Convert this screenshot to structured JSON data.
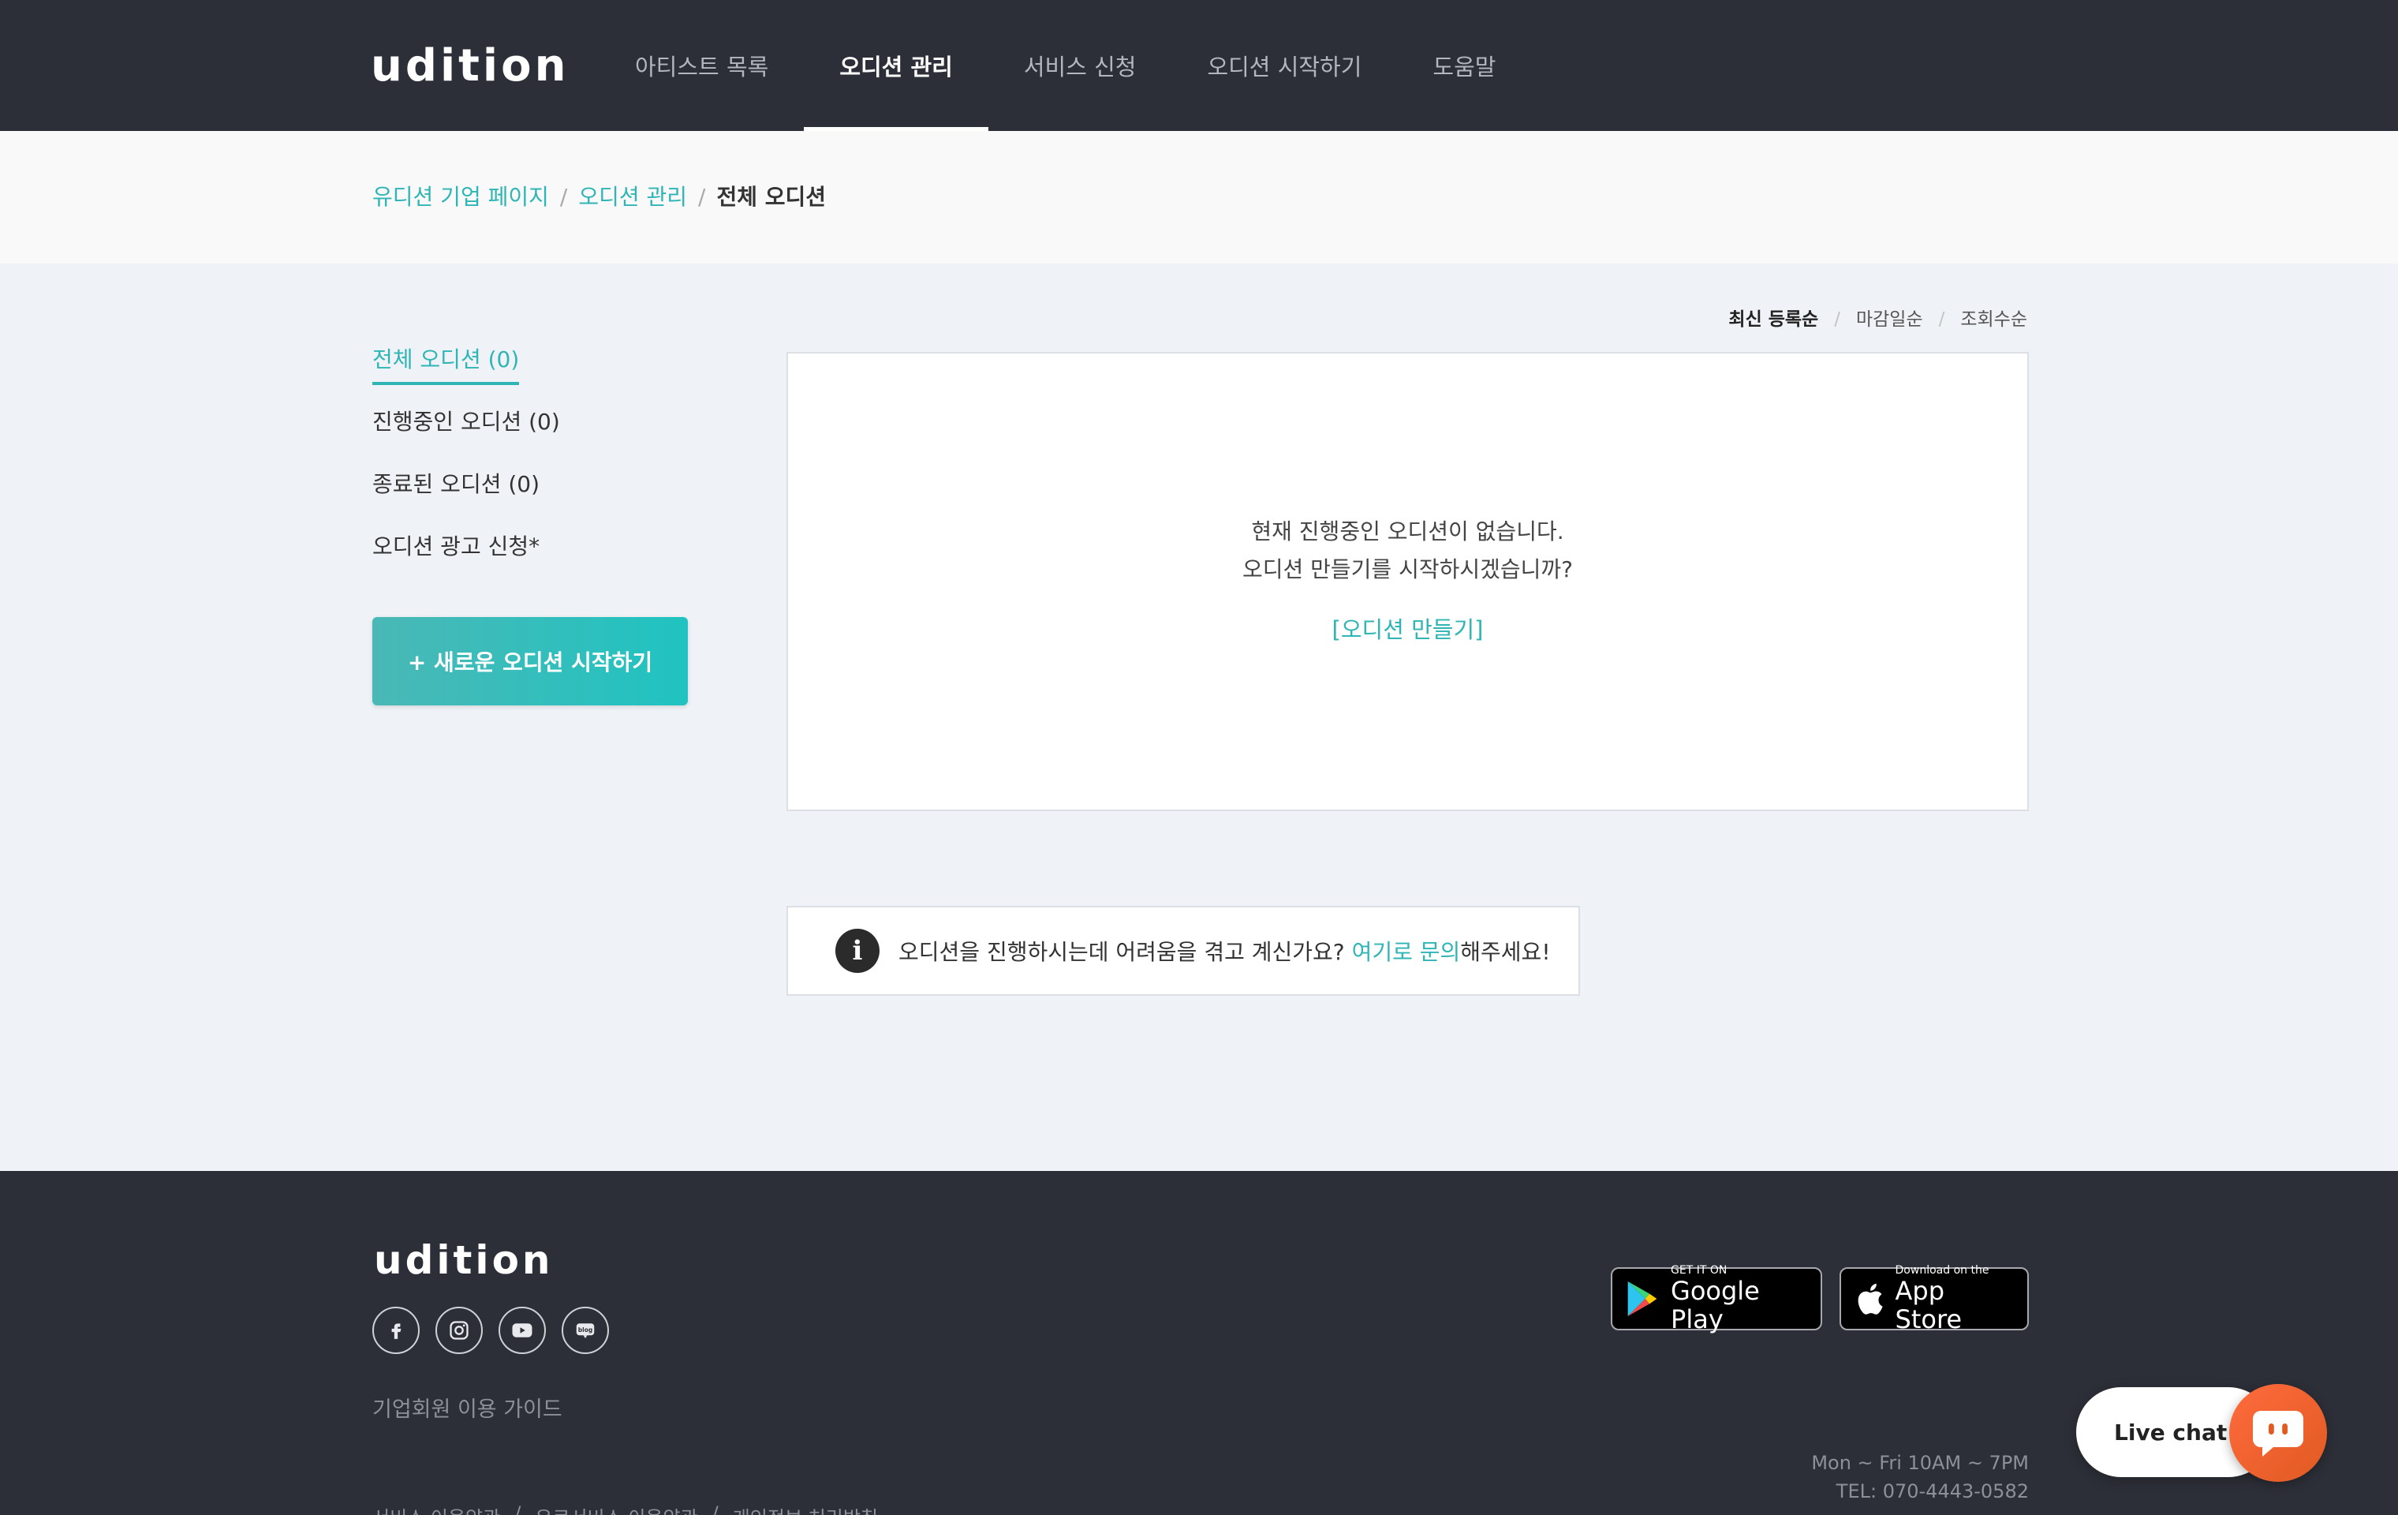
{
  "brand": {
    "logo_text": "udition"
  },
  "nav": {
    "items": [
      {
        "label": "아티스트 목록"
      },
      {
        "label": "오디션 관리"
      },
      {
        "label": "서비스 신청"
      },
      {
        "label": "오디션 시작하기"
      },
      {
        "label": "도움말"
      }
    ],
    "active_index": 1
  },
  "breadcrumb": {
    "items": [
      "유디션 기업 페이지",
      "오디션 관리",
      "전체 오디션"
    ],
    "separator": "/"
  },
  "sort": {
    "options": [
      "최신 등록순",
      "마감일순",
      "조회수순"
    ],
    "separator": "/",
    "active_index": 0
  },
  "sidebar": {
    "items": [
      {
        "label": "전체 오디션 (0)"
      },
      {
        "label": "진행중인 오디션 (0)"
      },
      {
        "label": "종료된 오디션 (0)"
      },
      {
        "label": "오디션 광고 신청*"
      }
    ],
    "new_button": "+ 새로운 오디션 시작하기"
  },
  "empty": {
    "line1": "현재 진행중인 오디션이 없습니다.",
    "line2": "오디션 만들기를 시작하시겠습니까?",
    "cta": "[오디션 만들기]"
  },
  "help": {
    "icon": "info-icon",
    "text_before": "오디션을 진행하시는데 어려움을 겪고 계신가요? ",
    "link": "여기로 문의",
    "text_after": "해주세요!"
  },
  "footer": {
    "logo_text": "udition",
    "socials": [
      "facebook-icon",
      "instagram-icon",
      "youtube-icon",
      "blog-icon"
    ],
    "guide": "기업회원 이용 가이드",
    "terms": [
      "서비스 이용약관",
      "/",
      "유료서비스 이용약관",
      "/",
      "개인정보 처리방침"
    ],
    "google_play": {
      "small": "GET IT ON",
      "big": "Google Play"
    },
    "app_store": {
      "small": "Download on the",
      "big": "App Store"
    },
    "hours": "Mon ~ Fri 10AM ~ 7PM",
    "tel": "TEL: 070-4443-0582"
  },
  "livechat": {
    "label": "Live chat"
  },
  "colors": {
    "accent": "#2fb5b5",
    "header_bg": "#2d2f38",
    "page_bg": "#eff2f6"
  }
}
